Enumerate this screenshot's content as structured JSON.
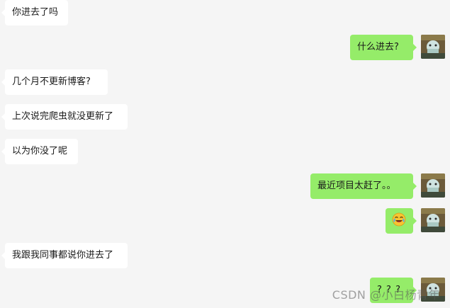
{
  "messages": [
    {
      "side": "left",
      "text": "你进去了吗"
    },
    {
      "side": "right",
      "text": "什么进去?"
    },
    {
      "side": "left",
      "text": "几个月不更新博客?"
    },
    {
      "side": "left",
      "text": "上次说完爬虫就没更新了"
    },
    {
      "side": "left",
      "text": "以为你没了呢"
    },
    {
      "side": "right",
      "text": "最近项目太赶了。。"
    },
    {
      "side": "right",
      "emoji": "laughing-crying-emoji"
    },
    {
      "side": "left",
      "text": "我跟我同事都说你进去了"
    },
    {
      "side": "right",
      "text": "? ? ?"
    }
  ],
  "watermark": "CSDN @小白杨青年",
  "colors": {
    "background": "#f5f5f5",
    "incoming_bubble": "#ffffff",
    "outgoing_bubble": "#95ec69"
  },
  "icons": {
    "avatar": "user-avatar-icon"
  }
}
